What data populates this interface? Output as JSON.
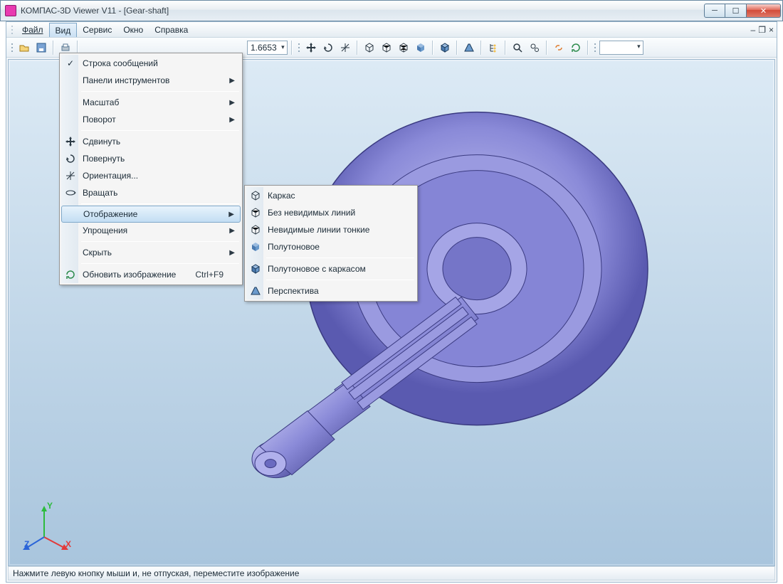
{
  "window": {
    "title": "КОМПАС-3D Viewer V11 - [Gear-shaft]"
  },
  "menubar": [
    "Файл",
    "Вид",
    "Сервис",
    "Окно",
    "Справка"
  ],
  "menubar_underline_idx": [
    0,
    0,
    0,
    0,
    0
  ],
  "toolbar": {
    "zoom": "1.6653"
  },
  "view_menu": {
    "items": [
      {
        "label": "Строка сообщений",
        "icon": "check",
        "checked": true
      },
      {
        "label": "Панели инструментов",
        "sub": true
      },
      {
        "sep": true
      },
      {
        "label": "Масштаб",
        "sub": true
      },
      {
        "label": "Поворот",
        "sub": true
      },
      {
        "sep": true
      },
      {
        "label": "Сдвинуть",
        "icon": "move"
      },
      {
        "label": "Повернуть",
        "icon": "rotate"
      },
      {
        "label": "Ориентация...",
        "icon": "orient"
      },
      {
        "label": "Вращать",
        "icon": "spin"
      },
      {
        "sep": true
      },
      {
        "label": "Отображение",
        "sub": true,
        "highlight": true
      },
      {
        "label": "Упрощения",
        "sub": true
      },
      {
        "sep": true
      },
      {
        "label": "Скрыть",
        "sub": true
      },
      {
        "sep": true
      },
      {
        "label": "Обновить изображение",
        "icon": "refresh",
        "shortcut": "Ctrl+F9"
      }
    ]
  },
  "display_submenu": {
    "items": [
      {
        "label": "Каркас",
        "icon": "wire"
      },
      {
        "label": "Без невидимых линий",
        "icon": "nohidden"
      },
      {
        "label": "Невидимые линии тонкие",
        "icon": "thinhidden"
      },
      {
        "label": "Полутоновое",
        "icon": "shaded"
      },
      {
        "sep": true
      },
      {
        "label": "Полутоновое с каркасом",
        "icon": "shadededge"
      },
      {
        "sep": true
      },
      {
        "label": "Перспектива",
        "icon": "persp"
      }
    ]
  },
  "statusbar": {
    "text": "Нажмите левую кнопку мыши и, не отпуская, переместите изображение"
  },
  "triad": {
    "x": "X",
    "y": "Y",
    "z": "Z"
  },
  "colors": {
    "accent": "#c3def3",
    "gear": "#8a8ad8",
    "gear_dark": "#5a5ab0"
  }
}
